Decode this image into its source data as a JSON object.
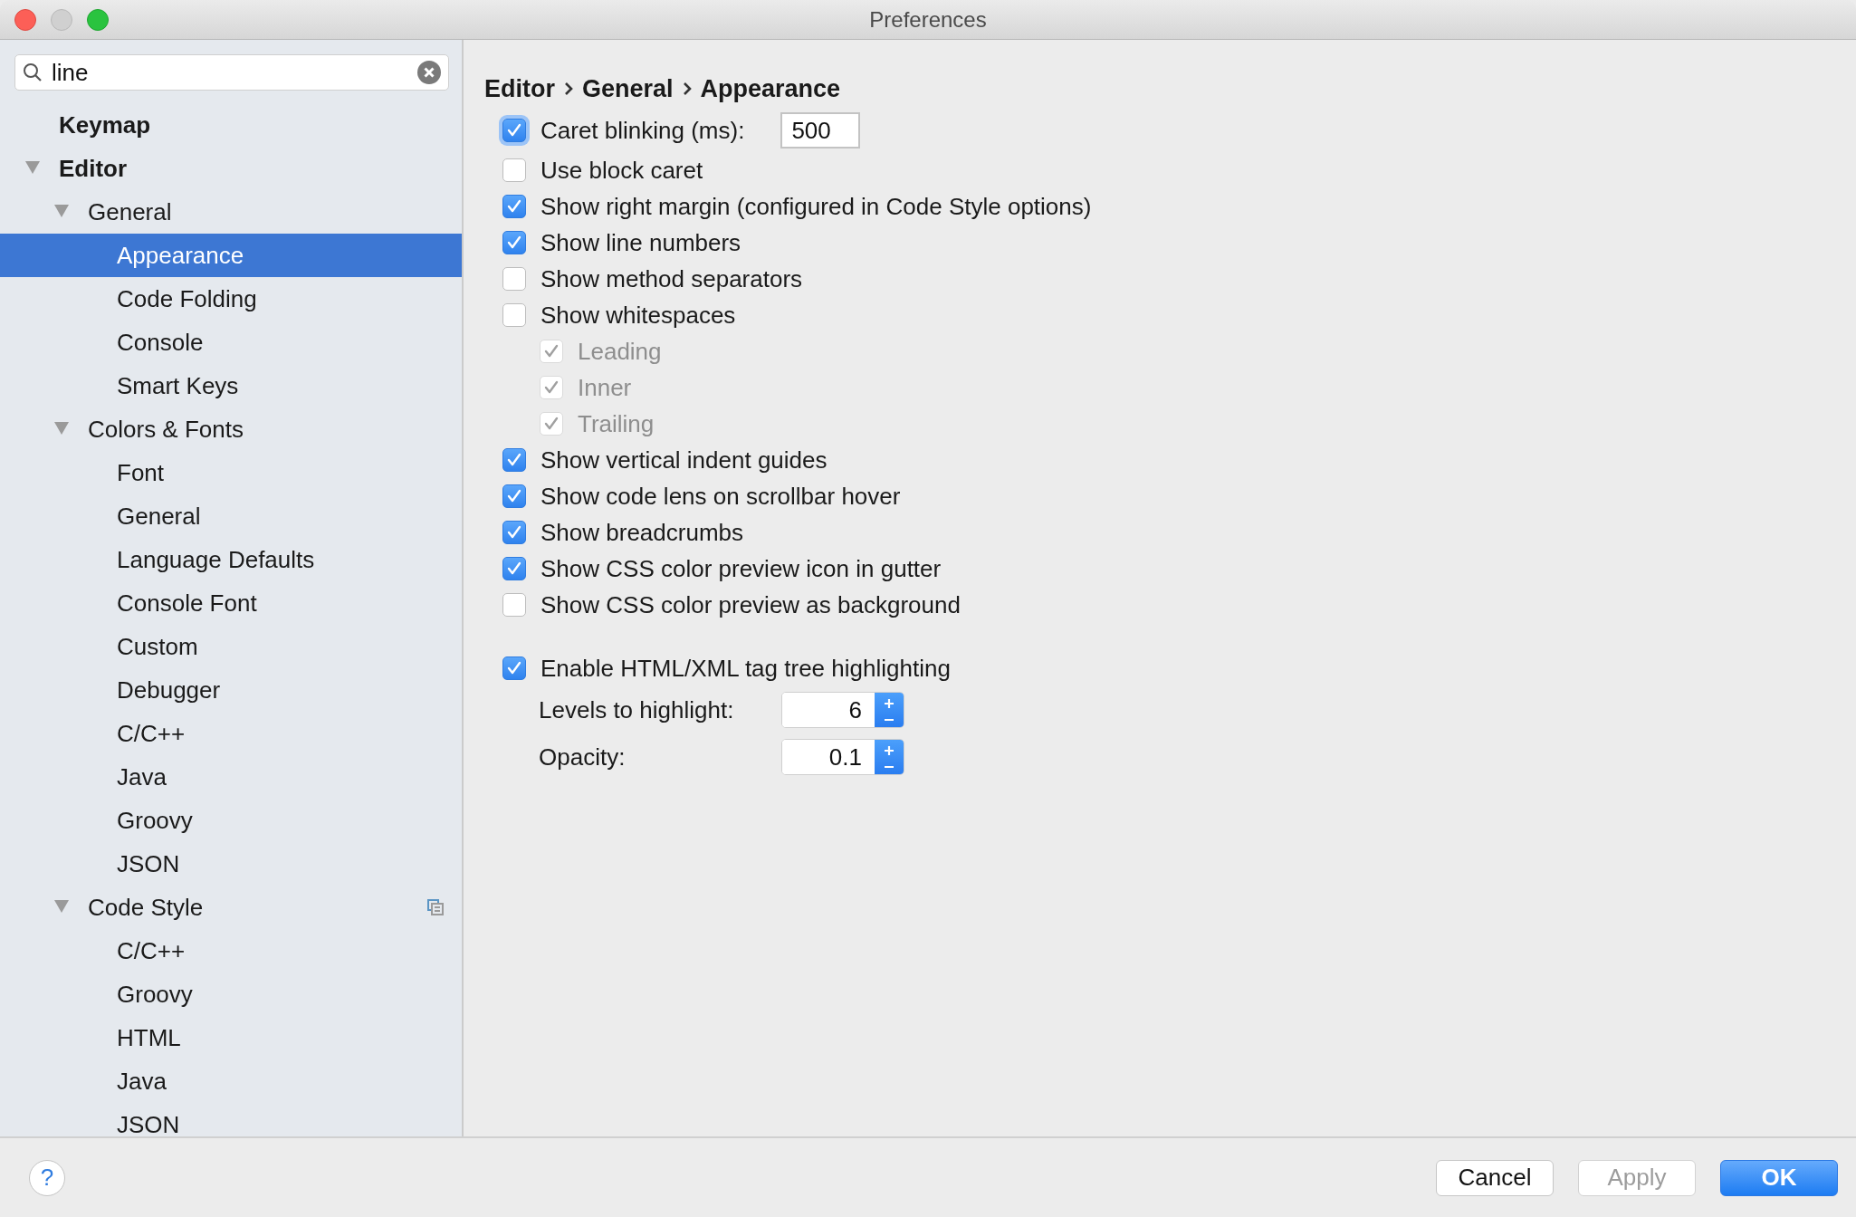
{
  "window": {
    "title": "Preferences"
  },
  "search": {
    "value": "line"
  },
  "tree": [
    {
      "label": "Keymap",
      "selected": false
    },
    {
      "label": "Editor",
      "selected": false,
      "expanded": true,
      "children": [
        {
          "label": "General",
          "selected": false,
          "expanded": true,
          "children": [
            {
              "label": "Appearance",
              "selected": true
            },
            {
              "label": "Code Folding",
              "selected": false
            },
            {
              "label": "Console",
              "selected": false
            },
            {
              "label": "Smart Keys",
              "selected": false
            }
          ]
        },
        {
          "label": "Colors & Fonts",
          "selected": false,
          "expanded": true,
          "children": [
            {
              "label": "Font",
              "selected": false
            },
            {
              "label": "General",
              "selected": false
            },
            {
              "label": "Language Defaults",
              "selected": false
            },
            {
              "label": "Console Font",
              "selected": false
            },
            {
              "label": "Custom",
              "selected": false
            },
            {
              "label": "Debugger",
              "selected": false
            },
            {
              "label": "C/C++",
              "selected": false
            },
            {
              "label": "Java",
              "selected": false
            },
            {
              "label": "Groovy",
              "selected": false
            },
            {
              "label": "JSON",
              "selected": false
            }
          ]
        },
        {
          "label": "Code Style",
          "selected": false,
          "expanded": true,
          "has_copy_icon": true,
          "children": [
            {
              "label": "C/C++",
              "selected": false
            },
            {
              "label": "Groovy",
              "selected": false
            },
            {
              "label": "HTML",
              "selected": false
            },
            {
              "label": "Java",
              "selected": false
            },
            {
              "label": "JSON",
              "selected": false
            }
          ]
        }
      ]
    }
  ],
  "breadcrumb": [
    "Editor",
    "General",
    "Appearance"
  ],
  "options": [
    {
      "kind": "checkbox-field",
      "label": "Caret blinking (ms):",
      "checked": true,
      "focused": true,
      "value": "500"
    },
    {
      "kind": "checkbox",
      "label": "Use block caret",
      "checked": false,
      "focused": false
    },
    {
      "kind": "checkbox",
      "label": "Show right margin (configured in Code Style options)",
      "checked": true,
      "focused": false
    },
    {
      "kind": "checkbox",
      "label": "Show line numbers",
      "checked": true,
      "focused": false
    },
    {
      "kind": "checkbox",
      "label": "Show method separators",
      "checked": false,
      "focused": false
    },
    {
      "kind": "checkbox",
      "label": "Show whitespaces",
      "checked": false,
      "focused": false,
      "children": [
        {
          "label": "Leading",
          "checked": true,
          "disabled": true
        },
        {
          "label": "Inner",
          "checked": true,
          "disabled": true
        },
        {
          "label": "Trailing",
          "checked": true,
          "disabled": true
        }
      ]
    },
    {
      "kind": "checkbox",
      "label": "Show vertical indent guides",
      "checked": true,
      "focused": false
    },
    {
      "kind": "checkbox",
      "label": "Show code lens on scrollbar hover",
      "checked": true,
      "focused": false
    },
    {
      "kind": "checkbox",
      "label": "Show breadcrumbs",
      "checked": true,
      "focused": false
    },
    {
      "kind": "checkbox",
      "label": "Show CSS color preview icon in gutter",
      "checked": true,
      "focused": false
    },
    {
      "kind": "checkbox",
      "label": "Show CSS color preview as background",
      "checked": false,
      "focused": false
    }
  ],
  "highlighting": {
    "label": "Enable HTML/XML tag tree highlighting",
    "checked": true,
    "spinners": [
      {
        "label": "Levels to highlight:",
        "value": "6"
      },
      {
        "label": "Opacity:",
        "value": "0.1"
      }
    ]
  },
  "footer": {
    "help": "?",
    "buttons": [
      {
        "label": "Cancel",
        "kind": "normal"
      },
      {
        "label": "Apply",
        "kind": "disabled"
      },
      {
        "label": "OK",
        "kind": "default"
      }
    ]
  }
}
